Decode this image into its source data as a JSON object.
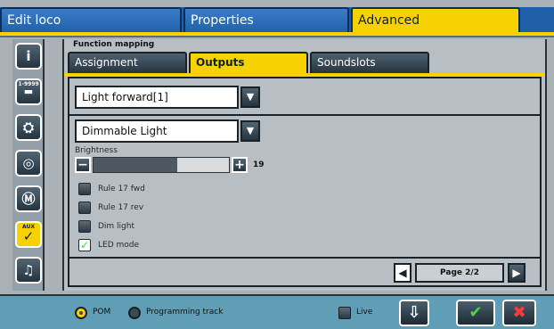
{
  "window": {
    "tabs": [
      {
        "label": "Edit loco",
        "active": false
      },
      {
        "label": "Properties",
        "active": false
      },
      {
        "label": "Advanced",
        "active": true
      }
    ]
  },
  "sidebar": {
    "items": [
      {
        "icon": "info-icon",
        "glyph": "i",
        "small": "",
        "active": false
      },
      {
        "icon": "address-icon",
        "glyph": "▬",
        "small": "1-9999",
        "active": false
      },
      {
        "icon": "loco-speed-icon",
        "glyph": "⛭",
        "small": "",
        "active": false
      },
      {
        "icon": "steering-wheel-icon",
        "glyph": "◎",
        "small": "",
        "active": false
      },
      {
        "icon": "motor-icon",
        "glyph": "Ⓜ",
        "small": "",
        "active": false
      },
      {
        "icon": "aux-output-icon",
        "glyph": "✓",
        "small": "AUX",
        "active": true
      },
      {
        "icon": "sound-icon",
        "glyph": "♫",
        "small": "",
        "active": false
      }
    ]
  },
  "main": {
    "section_title": "Function mapping",
    "subtabs": [
      {
        "label": "Assignment",
        "active": false
      },
      {
        "label": "Outputs",
        "active": true
      },
      {
        "label": "Soundslots",
        "active": false
      }
    ],
    "output_select": {
      "value": "Light forward[1]"
    },
    "mode_select": {
      "value": "Dimmable Light"
    },
    "brightness": {
      "label": "Brightness",
      "value": "19",
      "level_fraction": 0.62
    },
    "options": [
      {
        "label": "Rule 17 fwd",
        "checked": false
      },
      {
        "label": "Rule 17 rev",
        "checked": false
      },
      {
        "label": "Dim light",
        "checked": false
      },
      {
        "label": "LED mode",
        "checked": true
      }
    ],
    "pager": {
      "text": "Page 2/2"
    }
  },
  "footer": {
    "pom_label": "POM",
    "pom_selected": true,
    "programming_track_label": "Programming track",
    "programming_track_selected": false,
    "live_label": "Live",
    "live_checked": false
  },
  "glyphs": {
    "dropdown": "▼",
    "minus": "−",
    "plus": "+",
    "check": "✓",
    "prev": "◀",
    "next": "▶",
    "read": "⇩",
    "ok": "✔",
    "cancel": "✖"
  },
  "colors": {
    "accent": "#f7d200",
    "tab_blue": "#1f5fa8",
    "footer": "#5f9eb5",
    "ok_green": "#4ad44a",
    "cancel_red": "#ff3b3b"
  }
}
